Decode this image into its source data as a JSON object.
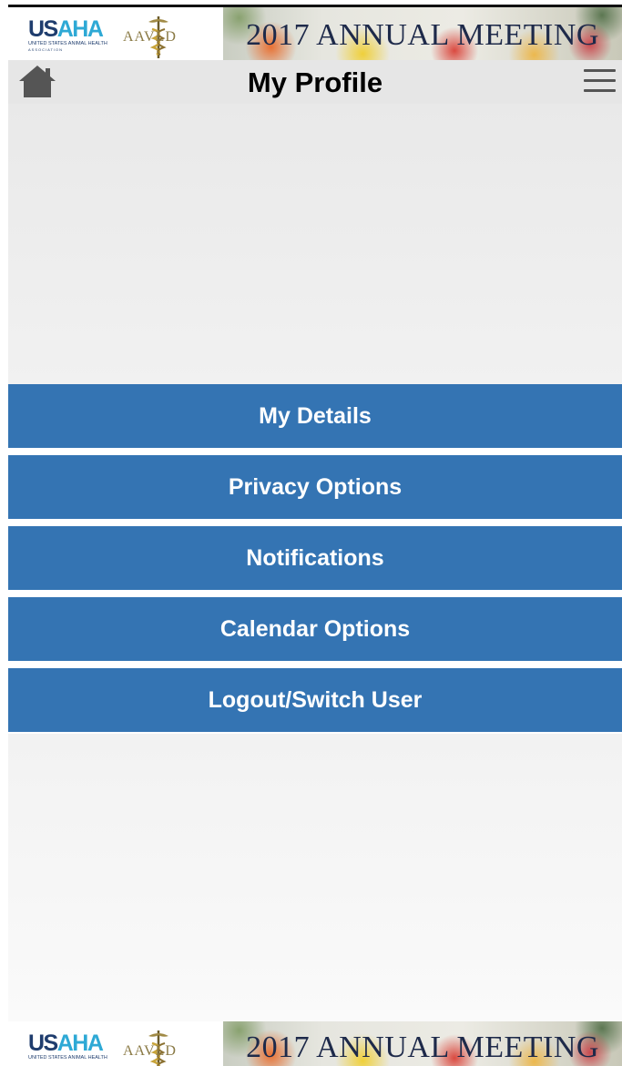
{
  "banner": {
    "usaha_us": "US",
    "usaha_aha": "AHA",
    "usaha_subtitle": "UNITED STATES ANIMAL HEALTH",
    "usaha_subtitle2": "ASSOCIATION",
    "aavld": "AAVLD",
    "meeting_title": "2017 ANNUAL MEETING"
  },
  "header": {
    "title": "My Profile",
    "home_icon": "home-icon",
    "menu_icon": "hamburger-menu-icon"
  },
  "menu": {
    "items": [
      {
        "label": "My Details"
      },
      {
        "label": "Privacy Options"
      },
      {
        "label": "Notifications"
      },
      {
        "label": "Calendar Options"
      },
      {
        "label": "Logout/Switch User"
      }
    ]
  },
  "colors": {
    "button_blue": "#3474b3",
    "header_gray": "#e6e6e6",
    "usaha_navy": "#1f3d6e",
    "usaha_cyan": "#2ea9d5"
  }
}
